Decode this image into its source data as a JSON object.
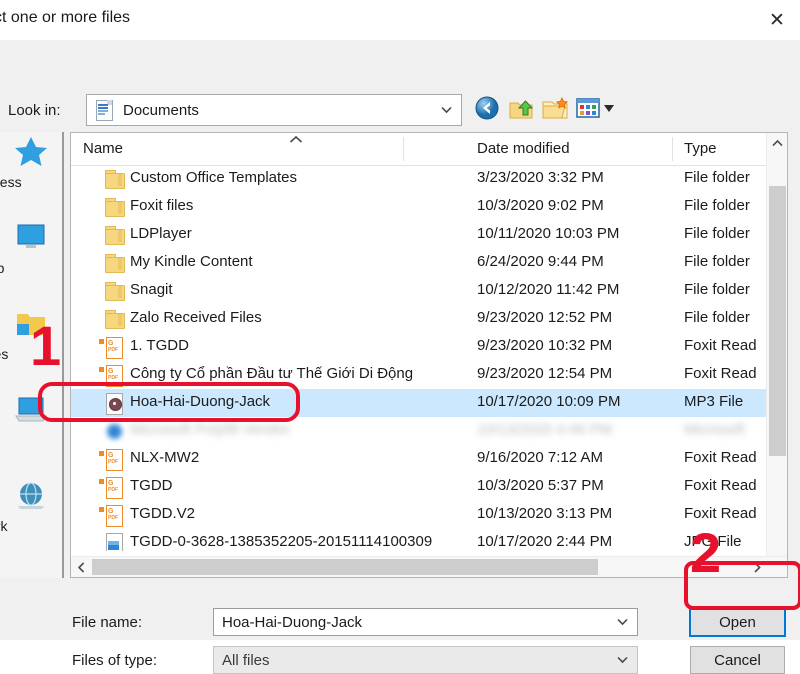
{
  "window": {
    "title": "ct one or more files",
    "close_label": "✕"
  },
  "lookin": {
    "label": "Look in:",
    "value": "Documents",
    "icon": "documents-folder-icon"
  },
  "toolbar": {
    "items": [
      {
        "name": "back-button",
        "icon": "back-arrow-icon"
      },
      {
        "name": "up-folder-button",
        "icon": "up-folder-icon"
      },
      {
        "name": "new-folder-button",
        "icon": "new-folder-icon"
      },
      {
        "name": "views-button",
        "icon": "views-grid-icon"
      }
    ]
  },
  "places": [
    {
      "label": "access",
      "icon": "quick-access-star-icon"
    },
    {
      "label": "ktop",
      "icon": "desktop-monitor-icon"
    },
    {
      "label": "aries",
      "icon": "libraries-folder-icon"
    },
    {
      "label": "PC",
      "icon": "this-pc-icon"
    },
    {
      "label": "work",
      "icon": "network-globe-icon"
    }
  ],
  "columns": [
    "Name",
    "Date modified",
    "Type"
  ],
  "files": [
    {
      "name": "Custom Office Templates",
      "date": "3/23/2020 3:32 PM",
      "type": "File folder",
      "icon": "folder",
      "selected": false,
      "blurred": false
    },
    {
      "name": "Foxit files",
      "date": "10/3/2020 9:02 PM",
      "type": "File folder",
      "icon": "folder",
      "selected": false,
      "blurred": false
    },
    {
      "name": "LDPlayer",
      "date": "10/11/2020 10:03 PM",
      "type": "File folder",
      "icon": "folder",
      "selected": false,
      "blurred": false
    },
    {
      "name": "My Kindle Content",
      "date": "6/24/2020 9:44 PM",
      "type": "File folder",
      "icon": "folder",
      "selected": false,
      "blurred": false
    },
    {
      "name": "Snagit",
      "date": "10/12/2020 11:42 PM",
      "type": "File folder",
      "icon": "folder",
      "selected": false,
      "blurred": false
    },
    {
      "name": "Zalo Received Files",
      "date": "9/23/2020 12:52 PM",
      "type": "File folder",
      "icon": "folder",
      "selected": false,
      "blurred": false
    },
    {
      "name": "1. TGDD",
      "date": "9/23/2020 10:32 PM",
      "type": "Foxit Read",
      "icon": "pdf",
      "selected": false,
      "blurred": false
    },
    {
      "name": "Công ty Cổ phần Đầu tư Thế Giới Di Động",
      "date": "9/23/2020 12:54 PM",
      "type": "Foxit Read",
      "icon": "pdf",
      "selected": false,
      "blurred": false
    },
    {
      "name": "Hoa-Hai-Duong-Jack",
      "date": "10/17/2020 10:09 PM",
      "type": "MP3 File",
      "icon": "mp3",
      "selected": true,
      "blurred": false
    },
    {
      "name": "Microsoft Polyfill Vendor",
      "date": "10/13/2020 4:46 PM",
      "type": "Microsoft",
      "icon": "blue",
      "selected": false,
      "blurred": true
    },
    {
      "name": "NLX-MW2",
      "date": "9/16/2020 7:12 AM",
      "type": "Foxit Read",
      "icon": "pdf",
      "selected": false,
      "blurred": false
    },
    {
      "name": "TGDD",
      "date": "10/3/2020 5:37 PM",
      "type": "Foxit Read",
      "icon": "pdf",
      "selected": false,
      "blurred": false
    },
    {
      "name": "TGDD.V2",
      "date": "10/13/2020 3:13 PM",
      "type": "Foxit Read",
      "icon": "pdf",
      "selected": false,
      "blurred": false
    },
    {
      "name": "TGDD-0-3628-1385352205-20151114100309",
      "date": "10/17/2020 2:44 PM",
      "type": "JPG File",
      "icon": "img",
      "selected": false,
      "blurred": false
    }
  ],
  "form": {
    "filename_label": "File name:",
    "filename_value": "Hoa-Hai-Duong-Jack",
    "filetype_label": "Files of type:",
    "filetype_value": "All files",
    "open_label": "Open",
    "cancel_label": "Cancel"
  },
  "annotations": {
    "step1": "1",
    "step2": "2",
    "color": "#e8112d"
  }
}
